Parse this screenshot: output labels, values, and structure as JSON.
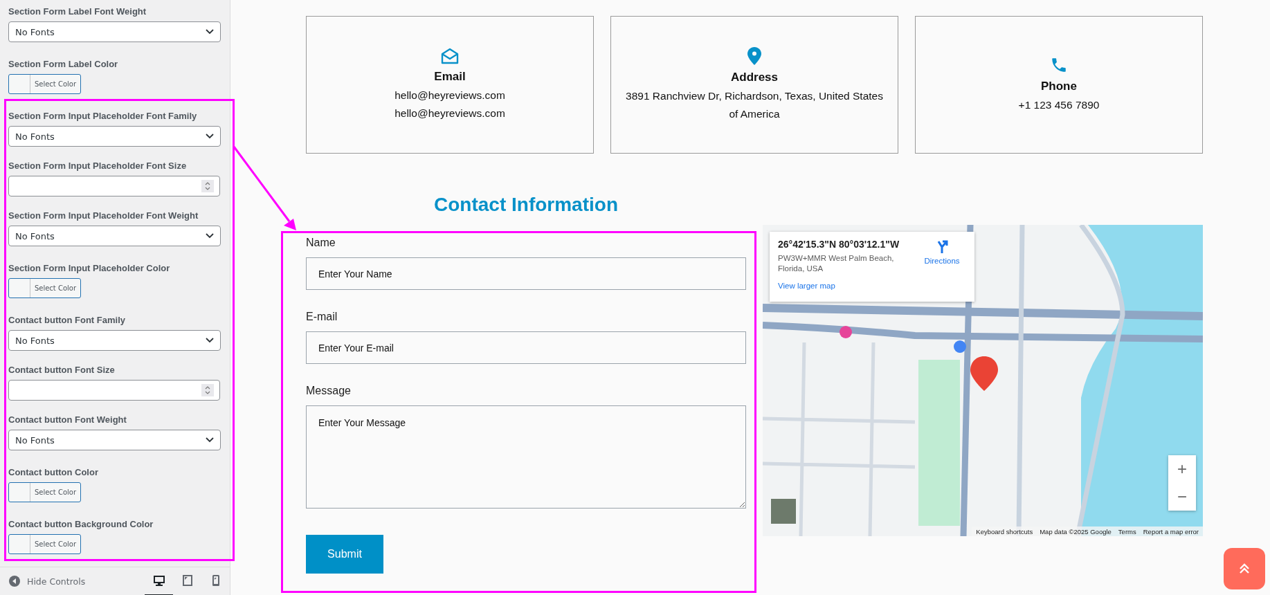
{
  "sidebar": {
    "controls": [
      {
        "kind": "select",
        "label": "Section Form Label Font Weight",
        "value": "No Fonts"
      },
      {
        "kind": "color",
        "label": "Section Form Label Color",
        "button": "Select Color"
      },
      {
        "kind": "select",
        "label": "Section Form Input Placeholder Font Family",
        "value": "No Fonts"
      },
      {
        "kind": "number",
        "label": "Section Form Input Placeholder Font Size"
      },
      {
        "kind": "select",
        "label": "Section Form Input Placeholder Font Weight",
        "value": "No Fonts"
      },
      {
        "kind": "color",
        "label": "Section Form Input Placeholder Color",
        "button": "Select Color"
      },
      {
        "kind": "select",
        "label": "Contact button Font Family",
        "value": "No Fonts"
      },
      {
        "kind": "number",
        "label": "Contact button Font Size"
      },
      {
        "kind": "select",
        "label": "Contact button Font Weight",
        "value": "No Fonts"
      },
      {
        "kind": "color",
        "label": "Contact button Color",
        "button": "Select Color"
      },
      {
        "kind": "color",
        "label": "Contact button Background Color",
        "button": "Select Color"
      }
    ],
    "footer": {
      "hide_label": "Hide Controls",
      "devices": [
        {
          "kind": "desktop",
          "selected": true
        },
        {
          "kind": "tablet",
          "selected": false
        },
        {
          "kind": "mobile",
          "selected": false
        }
      ]
    }
  },
  "info_cards": [
    {
      "kind": "email",
      "title": "Email",
      "lines": [
        "hello@heyreviews.com",
        "hello@heyreviews.com"
      ]
    },
    {
      "kind": "address",
      "title": "Address",
      "lines": [
        "3891 Ranchview Dr, Richardson, Texas, United States of America"
      ]
    },
    {
      "kind": "phone",
      "title": "Phone",
      "lines": [
        "+1 123 456 7890"
      ]
    }
  ],
  "heading": "Contact Information",
  "form": {
    "fields": [
      {
        "kind": "input",
        "label": "Name",
        "placeholder": "Enter Your Name"
      },
      {
        "kind": "input",
        "label": "E-mail",
        "placeholder": "Enter Your E-mail"
      },
      {
        "kind": "textarea",
        "label": "Message",
        "placeholder": "Enter Your Message"
      }
    ],
    "submit": "Submit"
  },
  "map": {
    "info": {
      "coords": "26°42'15.3\"N 80°03'12.1\"W",
      "address": "PW3W+MMR West Palm Beach, Florida, USA",
      "directions": "Directions",
      "larger_link": "View larger map"
    },
    "zoom": [
      "+",
      "−"
    ],
    "footer": [
      "Keyboard shortcuts",
      "Map data ©2025 Google",
      "Terms",
      "Report a map error"
    ]
  }
}
